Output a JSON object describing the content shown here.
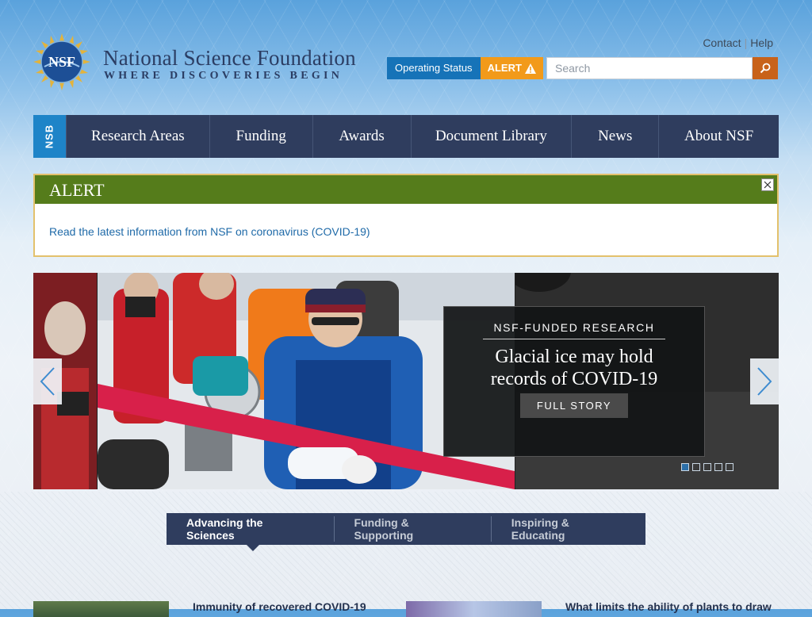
{
  "header": {
    "brand_title": "National Science Foundation",
    "brand_tagline": "WHERE DISCOVERIES BEGIN",
    "logo_text": "NSF",
    "util_links": {
      "contact": "Contact",
      "separator": "|",
      "help": "Help"
    },
    "operating_status_label": "Operating Status",
    "alert_badge_label": "ALERT",
    "search_placeholder": "Search"
  },
  "nav": {
    "nsb_label": "NSB",
    "items": [
      "Research Areas",
      "Funding",
      "Awards",
      "Document Library",
      "News",
      "About NSF"
    ]
  },
  "alert": {
    "heading": "ALERT",
    "link_text": "Read the latest information from NSF on coronavirus (COVID-19)"
  },
  "carousel": {
    "kicker": "NSF-FUNDED RESEARCH",
    "title_line1": "Glacial ice may hold",
    "title_line2": "records of COVID-19",
    "cta": "FULL STORY",
    "slide_count": 5,
    "active_slide": 1
  },
  "tabs": {
    "items": [
      "Advancing the Sciences",
      "Funding & Supporting",
      "Inspiring & Educating"
    ],
    "active_index": 0
  },
  "news": {
    "item1_title": "Immunity of recovered COVID-19",
    "item2_title": "What limits the ability of plants to draw"
  },
  "colors": {
    "nav_bg": "#2f3d5e",
    "nsb_blue": "#1e84c8",
    "alert_green": "#557c1b",
    "alert_orange": "#f29a1a",
    "search_button": "#c8621a",
    "status_blue": "#1673b8"
  }
}
